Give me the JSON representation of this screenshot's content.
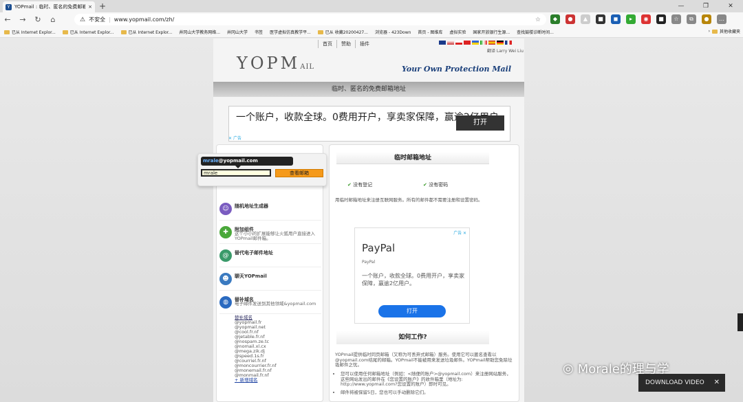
{
  "browser": {
    "tab_title": "YOPmail : 临时、匿名的免费邮箱地址",
    "close": "×",
    "new_tab": "+",
    "url_warning": "不安全",
    "url": "www.yopmail.com/zh/",
    "bookmarks": [
      "已从 Internet Explor...",
      "已从 Internet Explor...",
      "已从 Internet Explor...",
      "井冈山大学教务网络...",
      "井冈山大学",
      "书签",
      "医学虚拟仿真教学平...",
      "已从 收藏20200427...",
      "浏览器 - 423Down",
      "首页 - 图维库",
      "虚拟实验",
      "国家开放银行生源...",
      "查找鼓楼诊断时间..."
    ],
    "bookmark_right": "其他收藏夹"
  },
  "site": {
    "nav": [
      "首页",
      "赞助",
      "插件"
    ],
    "translator": "翻译 Larry Wei Liu",
    "logo": "YOPM",
    "logo_small": "AIL",
    "slogan": "Your Own Protection Mail",
    "header": "临时、匿名的免费邮箱地址",
    "banner": {
      "text": "一个账户，收款全球。0费用开户，享卖家保障，赢逾2亿用户。",
      "button": "打开",
      "ad_label": "广告"
    },
    "mail": {
      "tooltip_name": "mrale",
      "tooltip_domain": "@yopmail.com",
      "input_value": "mrale",
      "check_button": "查看邮箱"
    },
    "features": [
      {
        "title": "随机地址生成器",
        "desc": ""
      },
      {
        "title": "附加组件",
        "desc": "这个小小的扩展能够让火狐用户直接进入YOPmail邮件箱。"
      },
      {
        "title": "替代电子邮件地址",
        "desc": ""
      },
      {
        "title": "聊天YOPmail",
        "desc": ""
      },
      {
        "title": "替补域名",
        "desc": "电子邮件发送到其他领域&yopmail.com"
      }
    ],
    "domains_title": "替补域名",
    "domains": [
      "@yopmail.fr",
      "@yopmail.net",
      "@cool.fr.nf",
      "@jetable.fr.nf",
      "@nospam.ze.tc",
      "@nomail.xl.cx",
      "@mega.zik.dj",
      "@speed.1s.fr",
      "@courriel.fr.nf",
      "@moncourrier.fr.nf",
      "@monemail.fr.nf",
      "@monmail.fr.nf"
    ],
    "domains_more": "+ 新增域名",
    "right": {
      "title": "临时邮箱地址",
      "check1": "没有登记",
      "check2": "没有密码",
      "desc": "用临时邮箱地址来注册互联网服务。所有的邮件都不需要注册和设置密码。",
      "paypal": {
        "logo": "PayPal",
        "sub": "PayPal",
        "desc": "一个账户，收款全球。0费用开户，享卖家保障，赢逾2亿用户。",
        "button": "打开",
        "ad": "广告 ✕"
      },
      "how_title": "如何工作?",
      "how_text": "YOPmail提供临时同页邮箱（又称为可丢弃式邮箱）服务。使用它可以匿名查看以@yopmail.com结尾的邮箱。YOPmail不能被用来发送垃圾邮件。YOPmail帮助您免除垃圾邮件之忧。",
      "how_list": [
        "您可以使用任何邮箱地址（例如：<随便的账户>@yopmail.com）来注册网站服务，这些网站发出的邮件在《您设置的账户》的收件箱里（地址为: http://www.yopmail.com?您设置的账户）即时可见。",
        "邮件将被保留5日，您也可以手动删除它们。"
      ]
    }
  },
  "overlay": {
    "watermark": "Morale的理与学",
    "download": "DOWNLOAD VIDEO",
    "download_close": "✕"
  }
}
